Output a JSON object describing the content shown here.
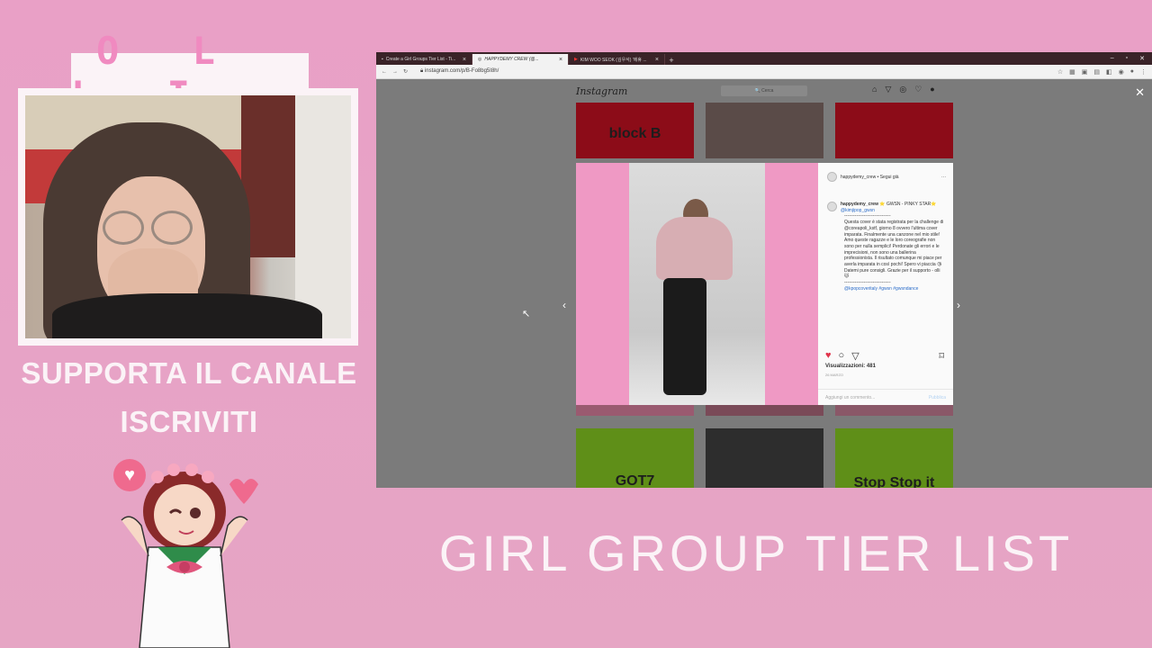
{
  "overlay": {
    "name": "O L L I",
    "support_line1": "SUPPORTA IL CANALE",
    "support_line2": "ISCRIVITI",
    "title": "GIRL GROUP TIER LIST"
  },
  "browser": {
    "tabs": [
      {
        "label": "Create a Girl Groups Tier List - Ti...",
        "active": false
      },
      {
        "label": "HAPPYDEMY CREW (@...",
        "active": true
      },
      {
        "label": "KIM WOO SEOK (김우석) '에휴 ...",
        "active": false
      }
    ],
    "new_tab": "+",
    "url": "instagram.com/p/B-Fo8bg5I8h/",
    "window_controls": [
      "–",
      "▫",
      "✕"
    ]
  },
  "instagram": {
    "logo": "Instagram",
    "search_placeholder": "🔍 Cerca",
    "close": "✕",
    "thumbs_top": [
      "block B",
      "",
      ""
    ],
    "thumbs_bottom": [
      "GOT7",
      "",
      "Stop Stop it"
    ],
    "post": {
      "header_user": "happydemy_crew • Segui già",
      "more": "···",
      "author": "happydemy_crew",
      "song": "⭐ GWSN - PINKY STAR⭐",
      "tag": "@kimjipop_gwsn",
      "divider": "-------------------------------",
      "caption": "Questa cover è stata registrata per la challenge di @coreapoli_kstf, giorno 8 ovvero l'ultima cover imparata. Finalmente una canzone nel mio stile! Amo queste ragazze e le loro coreografie non sono per nulla semplici! Perdonate gli errori e le imprecisioni, non sono una ballerina professionista. Il risultato comunque mi piace per averla imparata in così pochi! Spero vi piaccia 😘 Datemi pure consigli. Grazie per il supporto - olli 🐱",
      "hashtags": "@kpopcoveritaly #gwsn #gwsndance",
      "views": "Visualizzazioni: 481",
      "date": "26 MARZO",
      "comment_placeholder": "Aggiungi un commento...",
      "publish": "Pubblica"
    }
  }
}
